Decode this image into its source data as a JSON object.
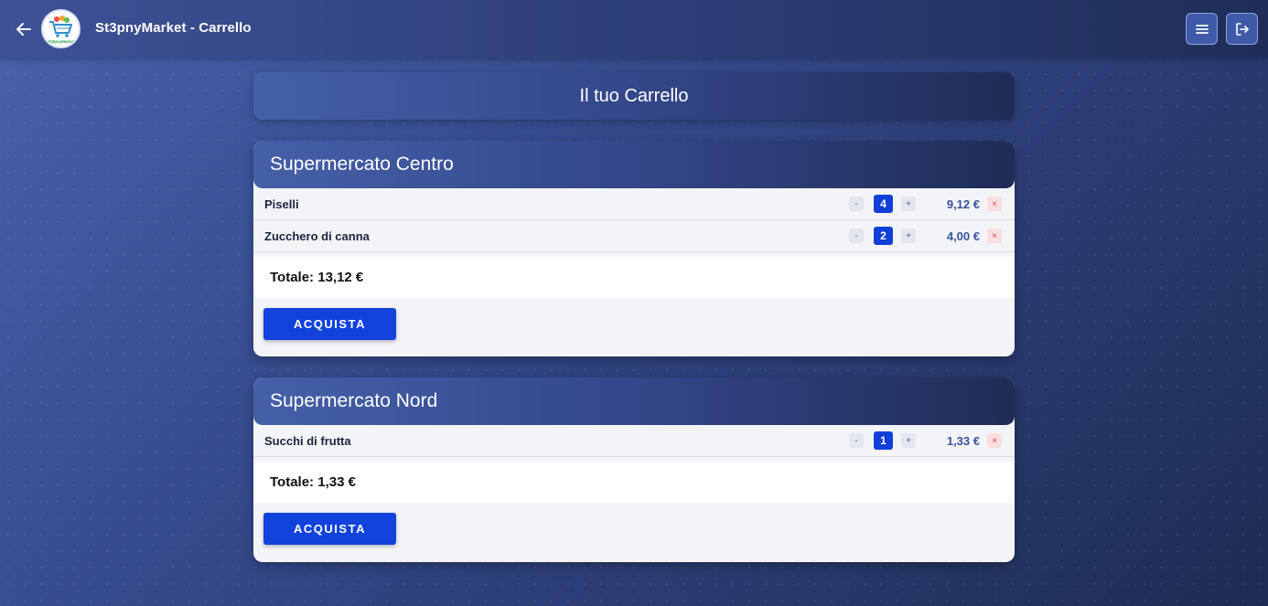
{
  "app": {
    "title": "St3pnyMarket - Carrello",
    "logo_text": "St3pnyMarket"
  },
  "header": {
    "back_icon": "arrow-left-icon",
    "menu_icon": "hamburger-menu-icon",
    "logout_icon": "logout-icon"
  },
  "page": {
    "title": "Il tuo Carrello"
  },
  "carts": [
    {
      "store": "Supermercato Centro",
      "items": [
        {
          "name": "Piselli",
          "minus": "-",
          "qty": "4",
          "plus": "+",
          "price": "9,12 €",
          "remove": "×"
        },
        {
          "name": "Zucchero di canna",
          "minus": "-",
          "qty": "2",
          "plus": "+",
          "price": "4,00 €",
          "remove": "×"
        }
      ],
      "total": "Totale: 13,12 €",
      "buy_label": "ACQUISTA"
    },
    {
      "store": "Supermercato Nord",
      "items": [
        {
          "name": "Succhi di frutta",
          "minus": "-",
          "qty": "1",
          "plus": "+",
          "price": "1,33 €",
          "remove": "×"
        }
      ],
      "total": "Totale: 1,33 €",
      "buy_label": "ACQUISTA"
    }
  ],
  "colors": {
    "accent": "#1142dc",
    "header_gradient_start": "#4560a8",
    "header_gradient_end": "#1f2c55",
    "remove": "#e0474c",
    "price": "#3653a0"
  }
}
